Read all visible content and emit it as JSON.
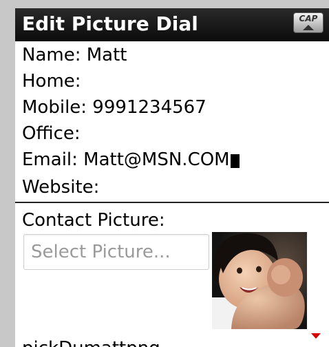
{
  "title_bar": {
    "title": "Edit Picture Dial",
    "cap_indicator": "CAP"
  },
  "fields": {
    "name": "Name: Matt",
    "home": "Home:",
    "mobile": "Mobile: 9991234567",
    "office": "Office:",
    "email": "Email: Matt@MSN.COM",
    "website": "Website:"
  },
  "contact_picture": {
    "label": "Contact Picture:",
    "select_placeholder": "Select Picture..."
  },
  "next_field_partial": "pickDumattpng",
  "colors": {
    "title_bar_bg": "#111111",
    "title_text": "#ffffff",
    "scroll_arrow": "#d40000",
    "placeholder_text": "#9a9a9a"
  },
  "icons": {
    "cap_indicator": "caps-lock-icon",
    "scroll_down": "scroll-down-arrow-icon",
    "text_cursor": "text-cursor"
  }
}
